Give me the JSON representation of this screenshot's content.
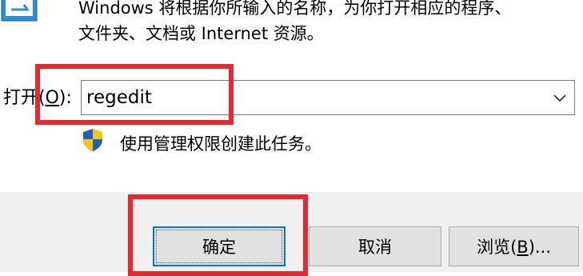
{
  "dialog": {
    "description_line1": "Windows 将根据你所输入的名称，为你打开相应的程序、",
    "description_line2": "文件夹、文档或 Internet 资源。",
    "open_label_prefix": "打开(",
    "open_label_hotkey": "O",
    "open_label_suffix": "):",
    "input_value": "regedit",
    "admin_note": "使用管理权限创建此任务。"
  },
  "buttons": {
    "ok_label": "确定",
    "cancel_label": "取消",
    "browse_prefix": "浏览(",
    "browse_hotkey": "B",
    "browse_suffix": ")..."
  },
  "colors": {
    "highlight": "#e8282f",
    "focus_border": "#0078d7",
    "button_face": "#e1e1e1",
    "dialog_footer": "#f0f0f0"
  },
  "icons": {
    "run": "run-dialog-icon",
    "shield": "uac-shield-icon",
    "dropdown": "chevron-down-icon"
  }
}
